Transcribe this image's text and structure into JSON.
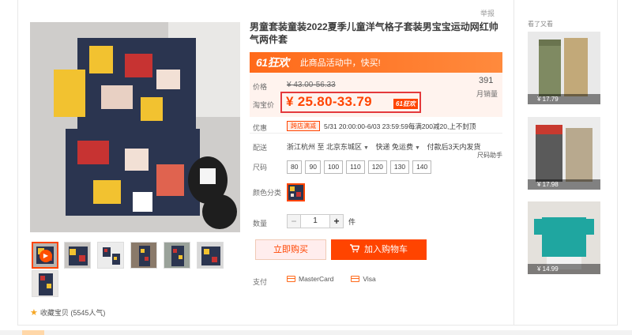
{
  "report": "举报",
  "title": "男童套装童装2022夏季儿童洋气格子套装男宝宝运动网红帅气两件套",
  "promo": {
    "logo": "61狂欢",
    "text": "此商品活动中，快买!"
  },
  "price": {
    "label_price": "价格",
    "old_price": "¥ 43.00-56.33",
    "label_taobao": "淘宝价",
    "current": "¥ 25.80-33.79",
    "badge": "61狂欢"
  },
  "sales": {
    "count": "391",
    "label": "月销量"
  },
  "coupon": {
    "label": "优惠",
    "tag": "跨店满减",
    "text": "5/31 20:00:00-6/03 23:59:59每满200减20,上不封顶"
  },
  "delivery": {
    "label": "配送",
    "from": "浙江杭州 至",
    "to": "北京东城区",
    "express": "快递 免运费",
    "ship": "付款后3天内发货"
  },
  "size": {
    "label": "尺码",
    "help": "尺码助手",
    "options": [
      "80",
      "90",
      "100",
      "110",
      "120",
      "130",
      "140"
    ]
  },
  "color": {
    "label": "颜色分类"
  },
  "quantity": {
    "label": "数量",
    "minus": "−",
    "value": "1",
    "plus": "+",
    "unit": "件"
  },
  "actions": {
    "buy": "立即购买",
    "cart": "加入购物车"
  },
  "payment": {
    "label": "支付",
    "methods": [
      "MasterCard",
      "Visa"
    ]
  },
  "favorite": "收藏宝贝 (5545人气)",
  "sidebar": {
    "title": "看了又看",
    "items": [
      {
        "price": "¥ 17.79"
      },
      {
        "price": "¥ 17.98"
      },
      {
        "price": "¥ 14.99"
      }
    ]
  },
  "colors": {
    "accent": "#ff4400",
    "promo": "#ff6a1a",
    "price_bg": "#fff3ee"
  }
}
